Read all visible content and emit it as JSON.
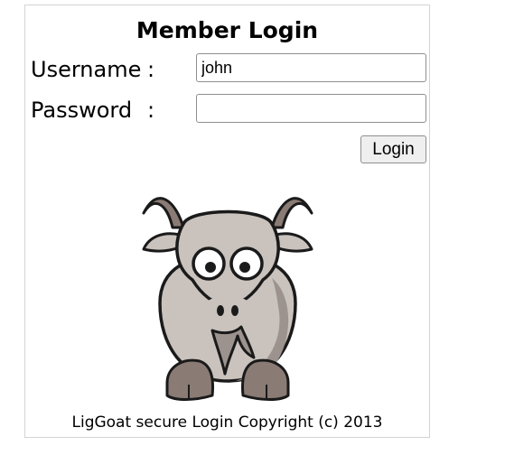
{
  "login": {
    "title": "Member Login",
    "username_label": "Username",
    "password_label": "Password",
    "colon": ":",
    "username_value": "john",
    "password_value": "",
    "submit_label": "Login"
  },
  "logo": {
    "icon": "goat-mascot-icon"
  },
  "footer": {
    "copyright": "LigGoat secure Login Copyright (c) 2013"
  },
  "colors": {
    "panel_border": "#d4d4d4",
    "goat_body": "#c9c2bd",
    "goat_horns": "#8a7b74",
    "button_bg": "#efefef"
  }
}
